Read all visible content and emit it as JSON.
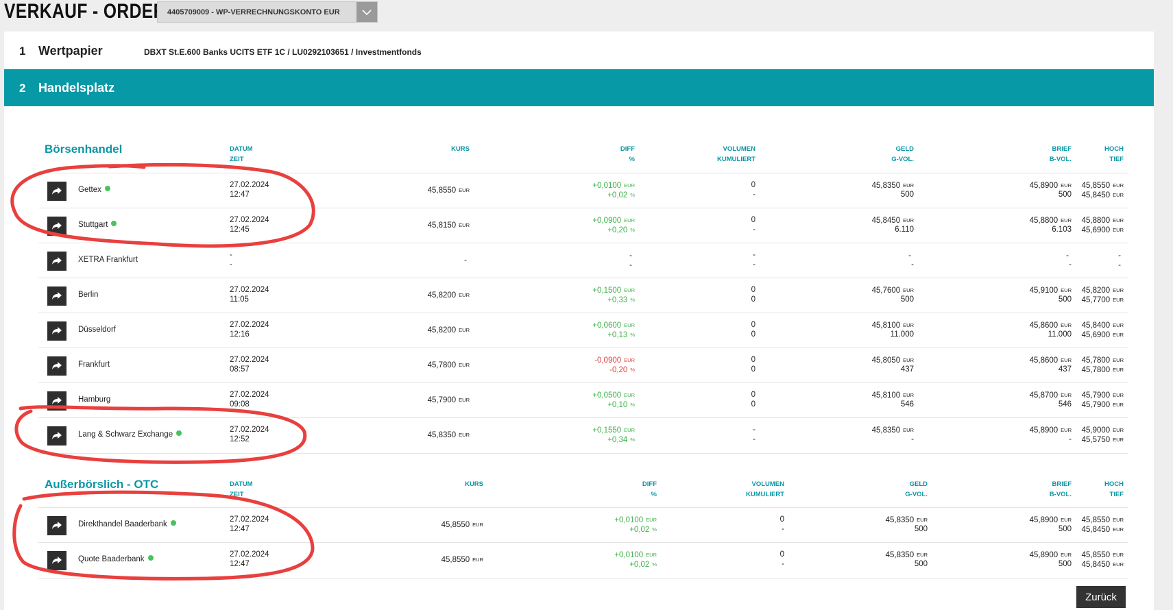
{
  "page_title": "VERKAUF - ORDER",
  "account": {
    "selected": "4405709009 - WP-VERRECHNUNGSKONTO EUR",
    "icon": "chevron-down-icon"
  },
  "steps": {
    "step1": {
      "number": "1",
      "title": "Wertpapier",
      "security": "DBXT St.E.600 Banks UCITS ETF 1C / LU0292103651 / Investmentfonds"
    },
    "step2": {
      "number": "2",
      "title": "Handelsplatz"
    }
  },
  "colors": {
    "accent": "#0899a7",
    "positive": "#3fb24a",
    "negative": "#e0413d",
    "live_dot": "#49c25e",
    "annotation": "#e8403e"
  },
  "exchange": {
    "title": "Börsenhandel",
    "headers": {
      "date": "DATUM",
      "time": "ZEIT",
      "price": "KURS",
      "diff": "DIFF",
      "diff_pct": "%",
      "volume": "VOLUMEN",
      "volume_sub": "KUMULIERT",
      "bid": "GELD",
      "bid_vol": "G-VOL.",
      "ask": "BRIEF",
      "ask_vol": "B-VOL.",
      "high": "HOCH",
      "low": "TIEF"
    },
    "rows": [
      {
        "name": "Gettex",
        "live": true,
        "date": "27.02.2024",
        "time": "12:47",
        "price": "45,8550",
        "price_cur": "EUR",
        "diff": "+0,0100",
        "diff_cur": "EUR",
        "diff_pct": "+0,02",
        "pct_unit": "%",
        "trend": "pos",
        "volume": "0",
        "volume_cum": "-",
        "bid": "45,8350",
        "bid_cur": "EUR",
        "bid_vol": "500",
        "ask": "45,8900",
        "ask_cur": "EUR",
        "ask_vol": "500",
        "high": "45,8550",
        "high_cur": "EUR",
        "low": "45,8450",
        "low_cur": "EUR"
      },
      {
        "name": "Stuttgart",
        "live": true,
        "date": "27.02.2024",
        "time": "12:45",
        "price": "45,8150",
        "price_cur": "EUR",
        "diff": "+0,0900",
        "diff_cur": "EUR",
        "diff_pct": "+0,20",
        "pct_unit": "%",
        "trend": "pos",
        "volume": "0",
        "volume_cum": "-",
        "bid": "45,8450",
        "bid_cur": "EUR",
        "bid_vol": "6.110",
        "ask": "45,8800",
        "ask_cur": "EUR",
        "ask_vol": "6.103",
        "high": "45,8800",
        "high_cur": "EUR",
        "low": "45,6900",
        "low_cur": "EUR"
      },
      {
        "name": "XETRA Frankfurt",
        "live": false,
        "date": "-",
        "time": "-",
        "price": "-",
        "price_cur": "",
        "diff": "-",
        "diff_cur": "",
        "diff_pct": "-",
        "pct_unit": "",
        "trend": "none",
        "volume": "-",
        "volume_cum": "-",
        "bid": "-",
        "bid_cur": "",
        "bid_vol": "-",
        "ask": "-",
        "ask_cur": "",
        "ask_vol": "-",
        "high": "-",
        "high_cur": "",
        "low": "-",
        "low_cur": ""
      },
      {
        "name": "Berlin",
        "live": false,
        "date": "27.02.2024",
        "time": "11:05",
        "price": "45,8200",
        "price_cur": "EUR",
        "diff": "+0,1500",
        "diff_cur": "EUR",
        "diff_pct": "+0,33",
        "pct_unit": "%",
        "trend": "pos",
        "volume": "0",
        "volume_cum": "0",
        "bid": "45,7600",
        "bid_cur": "EUR",
        "bid_vol": "500",
        "ask": "45,9100",
        "ask_cur": "EUR",
        "ask_vol": "500",
        "high": "45,8200",
        "high_cur": "EUR",
        "low": "45,7700",
        "low_cur": "EUR"
      },
      {
        "name": "Düsseldorf",
        "live": false,
        "date": "27.02.2024",
        "time": "12:16",
        "price": "45,8200",
        "price_cur": "EUR",
        "diff": "+0,0600",
        "diff_cur": "EUR",
        "diff_pct": "+0,13",
        "pct_unit": "%",
        "trend": "pos",
        "volume": "0",
        "volume_cum": "0",
        "bid": "45,8100",
        "bid_cur": "EUR",
        "bid_vol": "11.000",
        "ask": "45,8600",
        "ask_cur": "EUR",
        "ask_vol": "11.000",
        "high": "45,8400",
        "high_cur": "EUR",
        "low": "45,6900",
        "low_cur": "EUR"
      },
      {
        "name": "Frankfurt",
        "live": false,
        "date": "27.02.2024",
        "time": "08:57",
        "price": "45,7800",
        "price_cur": "EUR",
        "diff": "-0,0900",
        "diff_cur": "EUR",
        "diff_pct": "-0,20",
        "pct_unit": "%",
        "trend": "neg",
        "volume": "0",
        "volume_cum": "0",
        "bid": "45,8050",
        "bid_cur": "EUR",
        "bid_vol": "437",
        "ask": "45,8600",
        "ask_cur": "EUR",
        "ask_vol": "437",
        "high": "45,7800",
        "high_cur": "EUR",
        "low": "45,7800",
        "low_cur": "EUR"
      },
      {
        "name": "Hamburg",
        "live": false,
        "date": "27.02.2024",
        "time": "09:08",
        "price": "45,7900",
        "price_cur": "EUR",
        "diff": "+0,0500",
        "diff_cur": "EUR",
        "diff_pct": "+0,10",
        "pct_unit": "%",
        "trend": "pos",
        "volume": "0",
        "volume_cum": "0",
        "bid": "45,8100",
        "bid_cur": "EUR",
        "bid_vol": "546",
        "ask": "45,8700",
        "ask_cur": "EUR",
        "ask_vol": "546",
        "high": "45,7900",
        "high_cur": "EUR",
        "low": "45,7900",
        "low_cur": "EUR"
      },
      {
        "name": "Lang & Schwarz Exchange",
        "live": true,
        "date": "27.02.2024",
        "time": "12:52",
        "price": "45,8350",
        "price_cur": "EUR",
        "diff": "+0,1550",
        "diff_cur": "EUR",
        "diff_pct": "+0,34",
        "pct_unit": "%",
        "trend": "pos",
        "volume": "-",
        "volume_cum": "-",
        "bid": "45,8350",
        "bid_cur": "EUR",
        "bid_vol": "-",
        "ask": "45,8900",
        "ask_cur": "EUR",
        "ask_vol": "-",
        "high": "45,9000",
        "high_cur": "EUR",
        "low": "45,5750",
        "low_cur": "EUR"
      }
    ]
  },
  "otc": {
    "title": "Außerbörslich - OTC",
    "headers": {
      "date": "DATUM",
      "time": "ZEIT",
      "price": "KURS",
      "diff": "DIFF",
      "diff_pct": "%",
      "volume": "VOLUMEN",
      "volume_sub": "KUMULIERT",
      "bid": "GELD",
      "bid_vol": "G-VOL.",
      "ask": "BRIEF",
      "ask_vol": "B-VOL.",
      "high": "HOCH",
      "low": "TIEF"
    },
    "rows": [
      {
        "name": "Direkthandel Baaderbank",
        "live": true,
        "date": "27.02.2024",
        "time": "12:47",
        "price": "45,8550",
        "price_cur": "EUR",
        "diff": "+0,0100",
        "diff_cur": "EUR",
        "diff_pct": "+0,02",
        "pct_unit": "%",
        "trend": "pos",
        "volume": "0",
        "volume_cum": "-",
        "bid": "45,8350",
        "bid_cur": "EUR",
        "bid_vol": "500",
        "ask": "45,8900",
        "ask_cur": "EUR",
        "ask_vol": "500",
        "high": "45,8550",
        "high_cur": "EUR",
        "low": "45,8450",
        "low_cur": "EUR"
      },
      {
        "name": "Quote Baaderbank",
        "live": true,
        "date": "27.02.2024",
        "time": "12:47",
        "price": "45,8550",
        "price_cur": "EUR",
        "diff": "+0,0100",
        "diff_cur": "EUR",
        "diff_pct": "+0,02",
        "pct_unit": "%",
        "trend": "pos",
        "volume": "0",
        "volume_cum": "-",
        "bid": "45,8350",
        "bid_cur": "EUR",
        "bid_vol": "500",
        "ask": "45,8900",
        "ask_cur": "EUR",
        "ask_vol": "500",
        "high": "45,8550",
        "high_cur": "EUR",
        "low": "45,8450",
        "low_cur": "EUR"
      }
    ]
  },
  "back_button": "Zurück"
}
